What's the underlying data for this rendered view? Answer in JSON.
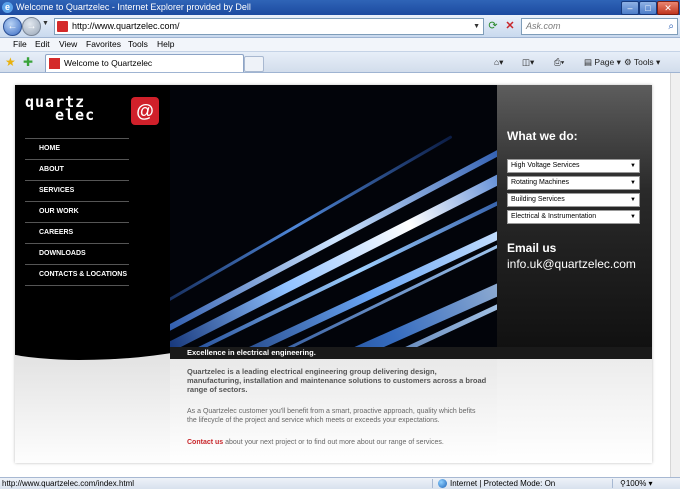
{
  "browser": {
    "window_title": "Welcome to Quartzelec - Internet Explorer provided by Dell",
    "url": "http://www.quartzelec.com/",
    "search_placeholder": "Ask.com",
    "menu": [
      "File",
      "Edit",
      "View",
      "Favorites",
      "Tools",
      "Help"
    ],
    "tab_title": "Welcome to Quartzelec",
    "command_page": "Page",
    "command_tools": "Tools",
    "status_url": "http://www.quartzelec.com/index.html",
    "status_zone": "Internet | Protected Mode: On",
    "zoom": "100%"
  },
  "site": {
    "logo_word1": "quartz",
    "logo_word2": "elec",
    "nav": [
      "HOME",
      "ABOUT",
      "SERVICES",
      "OUR WORK",
      "CAREERS",
      "DOWNLOADS",
      "CONTACTS & LOCATIONS"
    ],
    "what_we_do": "What we do:",
    "services": [
      "High Voltage Services",
      "Rotating Machines",
      "Building Services",
      "Electrical & Instrumentation"
    ],
    "email_heading": "Email us",
    "email": "info.uk@quartzelec.com",
    "tagline": "Excellence in electrical engineering.",
    "intro": "Quartzelec is a leading electrical engineering group delivering design, manufacturing, installation and maintenance solutions to customers across a broad range of sectors.",
    "para2": "As a Quartzelec customer you'll benefit from a smart, proactive approach, quality which befits the lifecycle of the project and service which meets or exceeds your expectations.",
    "contact_link": "Contact us",
    "contact_rest": " about your next project or to find out more about our range of services."
  }
}
